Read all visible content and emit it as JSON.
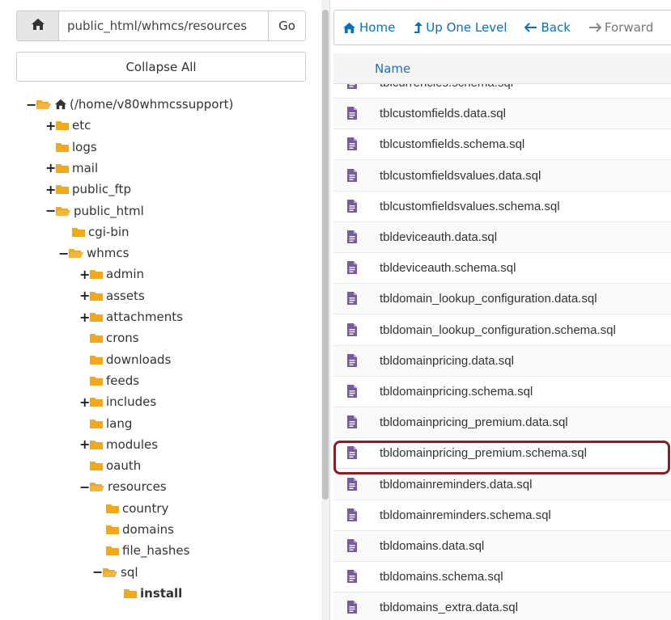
{
  "left": {
    "path_value": "public_html/whmcs/resources",
    "go_label": "Go",
    "collapse_label": "Collapse All",
    "tree": [
      {
        "label": "(/home/v80whmcssupport)",
        "toggle": "−",
        "open": true,
        "home": true,
        "bold": false
      },
      {
        "label": "etc",
        "toggle": "+",
        "open": false,
        "bold": false
      },
      {
        "label": "logs",
        "toggle": "",
        "open": false,
        "bold": false
      },
      {
        "label": "mail",
        "toggle": "+",
        "open": false,
        "bold": false
      },
      {
        "label": "public_ftp",
        "toggle": "+",
        "open": false,
        "bold": false
      },
      {
        "label": "public_html",
        "toggle": "−",
        "open": true,
        "bold": false
      },
      {
        "label": "cgi-bin",
        "toggle": "",
        "open": false,
        "bold": false
      },
      {
        "label": "whmcs",
        "toggle": "−",
        "open": true,
        "bold": false
      },
      {
        "label": "admin",
        "toggle": "+",
        "open": false,
        "bold": false
      },
      {
        "label": "assets",
        "toggle": "+",
        "open": false,
        "bold": false
      },
      {
        "label": "attachments",
        "toggle": "+",
        "open": false,
        "bold": false
      },
      {
        "label": "crons",
        "toggle": "",
        "open": false,
        "bold": false
      },
      {
        "label": "downloads",
        "toggle": "",
        "open": false,
        "bold": false
      },
      {
        "label": "feeds",
        "toggle": "",
        "open": false,
        "bold": false
      },
      {
        "label": "includes",
        "toggle": "+",
        "open": false,
        "bold": false
      },
      {
        "label": "lang",
        "toggle": "",
        "open": false,
        "bold": false
      },
      {
        "label": "modules",
        "toggle": "+",
        "open": false,
        "bold": false
      },
      {
        "label": "oauth",
        "toggle": "",
        "open": false,
        "bold": false
      },
      {
        "label": "resources",
        "toggle": "−",
        "open": true,
        "bold": false
      },
      {
        "label": "country",
        "toggle": "",
        "open": false,
        "bold": false
      },
      {
        "label": "domains",
        "toggle": "",
        "open": false,
        "bold": false
      },
      {
        "label": "file_hashes",
        "toggle": "",
        "open": false,
        "bold": false
      },
      {
        "label": "sql",
        "toggle": "−",
        "open": true,
        "bold": false
      },
      {
        "label": "install",
        "toggle": "",
        "open": false,
        "bold": true
      }
    ]
  },
  "toolbar": {
    "home_label": "Home",
    "up_label": "Up One Level",
    "back_label": "Back",
    "forward_label": "Forward"
  },
  "table": {
    "header_name": "Name",
    "files": [
      "tblcurrencies.schema.sql",
      "tblcustomfields.data.sql",
      "tblcustomfields.schema.sql",
      "tblcustomfieldsvalues.data.sql",
      "tblcustomfieldsvalues.schema.sql",
      "tbldeviceauth.data.sql",
      "tbldeviceauth.schema.sql",
      "tbldomain_lookup_configuration.data.sql",
      "tbldomain_lookup_configuration.schema.sql",
      "tbldomainpricing.data.sql",
      "tbldomainpricing.schema.sql",
      "tbldomainpricing_premium.data.sql",
      "tbldomainpricing_premium.schema.sql",
      "tbldomainreminders.data.sql",
      "tbldomainreminders.schema.sql",
      "tbldomains.data.sql",
      "tbldomains.schema.sql",
      "tbldomains_extra.data.sql"
    ],
    "highlighted_file": "tbldomainpricing_premium.schema.sql"
  },
  "colors": {
    "folder": "#f0a81e",
    "file_icon": "#7a5a9e",
    "link": "#0d6fb8",
    "highlight": "#8b1d24"
  }
}
